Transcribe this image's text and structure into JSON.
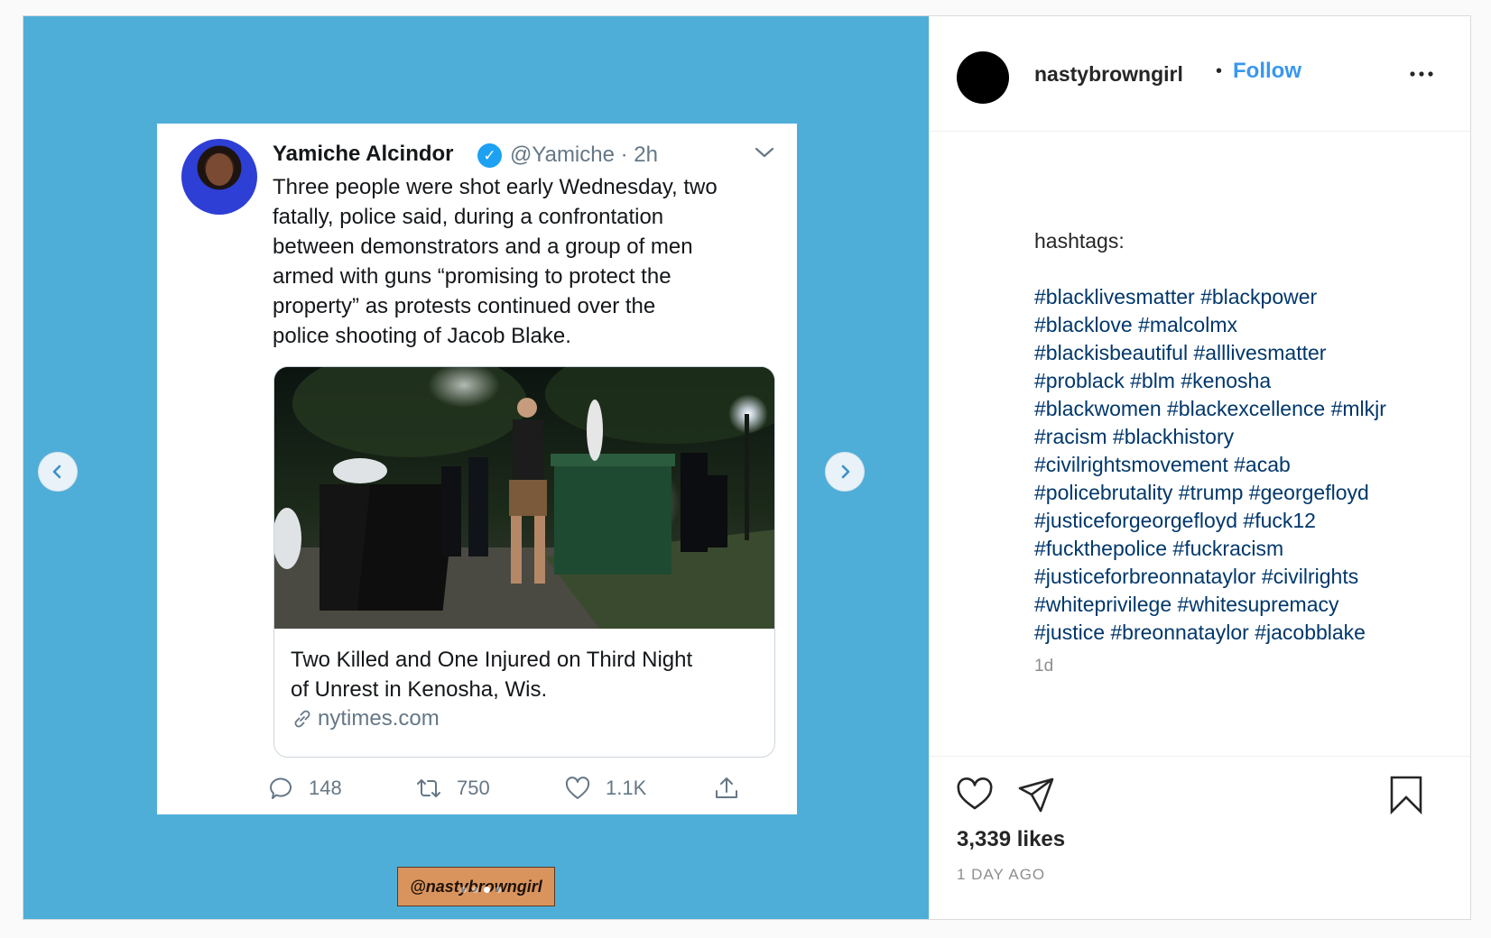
{
  "tweet": {
    "author_name": "Yamiche Alcindor",
    "handle_time": "@Yamiche · 2h",
    "text": "Three people were shot early Wednesday, two\nfatally, police  said, during a confrontation\nbetween demonstrators and a group of men\narmed with guns “promising to protect the\nproperty” as protests continued over the\npolice shooting of Jacob Blake.",
    "link_title": "Two Killed and One Injured on Third Night\nof Unrest in Kenosha, Wis.",
    "link_domain": "nytimes.com",
    "replies": "148",
    "retweets": "750",
    "likes": "1.1K"
  },
  "watermark": "@nastybrowngirl",
  "carousel": {
    "count": 4,
    "active_index": 2
  },
  "post": {
    "username": "nastybrowngirl",
    "bullet": "•",
    "follow_label": "Follow",
    "caption_lead": "hashtags:",
    "hashtags": "#blacklivesmatter #blackpower\n#blacklove #malcolmx\n#blackisbeautiful #alllivesmatter\n#problack #blm #kenosha\n#blackwomen #blackexcellence #mlkjr\n#racism #blackhistory\n#civilrightsmovement #acab\n#policebrutality #trump #georgefloyd\n#justiceforgeorgefloyd #fuck12\n#fuckthepolice #fuckracism\n#justiceforbreonnataylor #civilrights\n#whiteprivilege #whitesupremacy\n#justice #breonnataylor #jacobblake",
    "caption_time": "1d",
    "likes_text": "3,339 likes",
    "date_text": "1 DAY AGO"
  },
  "icons": {
    "prev": "chevron-left-icon",
    "next": "chevron-right-icon",
    "more": "more-horizontal-icon",
    "like": "heart-icon",
    "share": "paper-plane-icon",
    "save": "bookmark-icon"
  },
  "colors": {
    "media_background": "#4faed8",
    "follow": "#3897f0",
    "hashtag": "#00376b",
    "verified": "#1da1f2"
  }
}
